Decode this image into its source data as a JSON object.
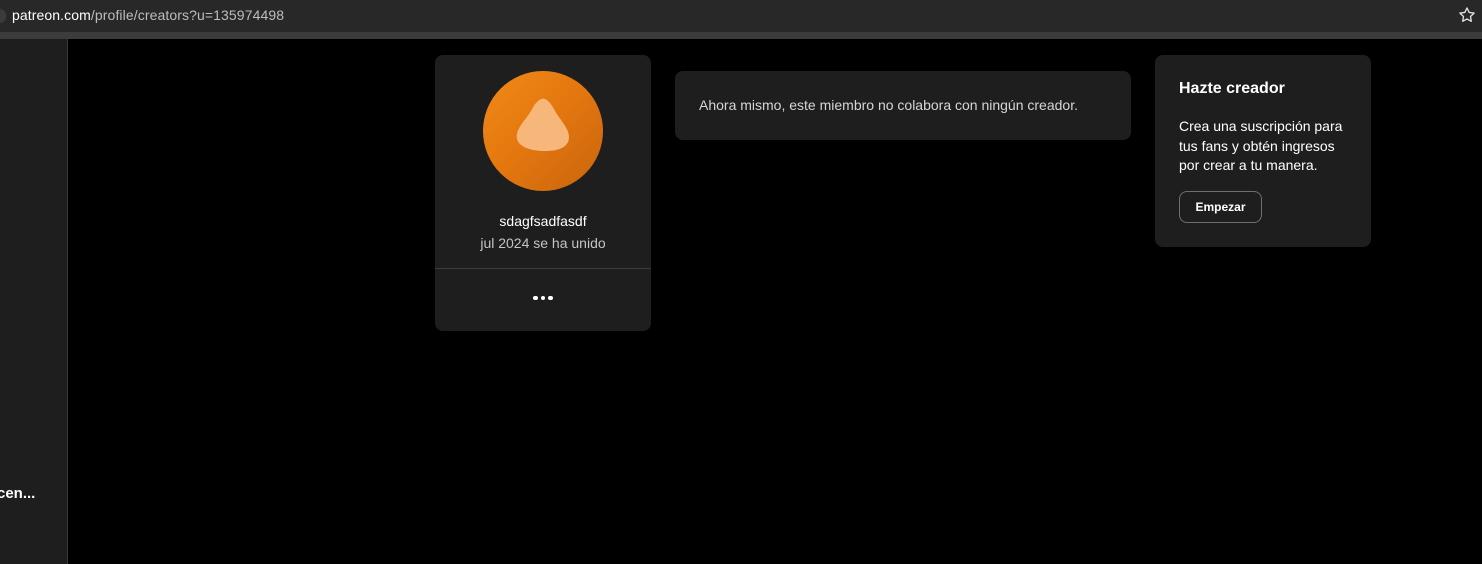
{
  "browser": {
    "url_host": "patreon.com",
    "url_path": "/profile/creators?u=135974498",
    "bookmark_icon": "star-icon"
  },
  "sidebar": {
    "truncated_item_label": "cen..."
  },
  "profile": {
    "avatar_icon": "default-avatar-icon",
    "avatar_color": "#e8790f",
    "username": "sdagfsadfasdf",
    "joined": "jul 2024 se ha unido",
    "more_icon": "more-options-icon"
  },
  "creators": {
    "empty_message": "Ahora mismo, este miembro no colabora con ningún creador."
  },
  "become_creator": {
    "title": "Hazte creador",
    "description": "Crea una suscripción para tus fans y obtén ingresos por crear a tu manera.",
    "button_label": "Empezar"
  }
}
